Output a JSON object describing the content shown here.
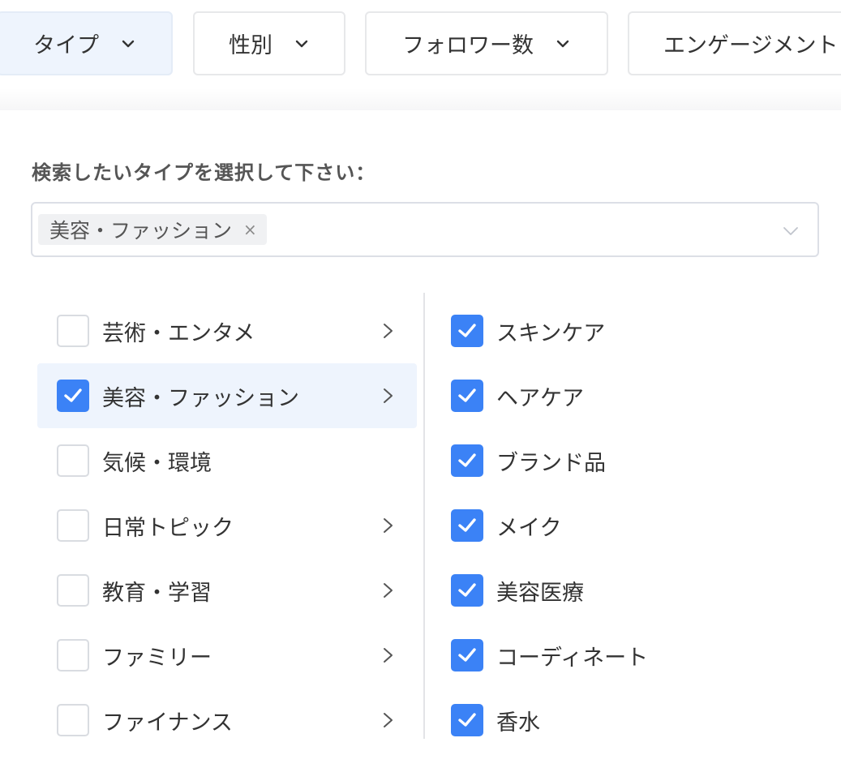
{
  "filters": [
    {
      "label": "タイプ",
      "active": true
    },
    {
      "label": "性別",
      "active": false
    },
    {
      "label": "フォロワー数",
      "active": false
    },
    {
      "label": "エンゲージメント",
      "active": false
    }
  ],
  "prompt": "検索したいタイプを選択して下さい：",
  "selected_tags": [
    {
      "label": "美容・ファッション",
      "remove_icon": "×"
    }
  ],
  "categories": [
    {
      "label": "芸術・エンタメ",
      "checked": false,
      "has_children": true
    },
    {
      "label": "美容・ファッション",
      "checked": true,
      "has_children": true,
      "highlighted": true
    },
    {
      "label": "気候・環境",
      "checked": false,
      "has_children": false
    },
    {
      "label": "日常トピック",
      "checked": false,
      "has_children": true
    },
    {
      "label": "教育・学習",
      "checked": false,
      "has_children": true
    },
    {
      "label": "ファミリー",
      "checked": false,
      "has_children": true
    },
    {
      "label": "ファイナンス",
      "checked": false,
      "has_children": true
    }
  ],
  "subcategories": [
    {
      "label": "スキンケア",
      "checked": true
    },
    {
      "label": "ヘアケア",
      "checked": true
    },
    {
      "label": "ブランド品",
      "checked": true
    },
    {
      "label": "メイク",
      "checked": true
    },
    {
      "label": "美容医療",
      "checked": true
    },
    {
      "label": "コーディネート",
      "checked": true
    },
    {
      "label": "香水",
      "checked": true
    }
  ],
  "colors": {
    "accent": "#3b82f6",
    "active_bg": "#eef4fd",
    "border": "#dcdfe6"
  }
}
